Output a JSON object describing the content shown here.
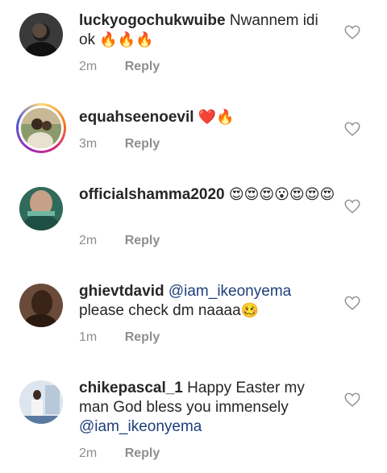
{
  "comments": [
    {
      "username": "luckyogochukwuibe",
      "text": "Nwannem idi ok",
      "emoji": "🔥🔥🔥",
      "time": "2m",
      "reply": "Reply"
    },
    {
      "username": "equahseenoevil",
      "text": "",
      "emoji": "❤️🔥",
      "time": "3m",
      "reply": "Reply"
    },
    {
      "username": "officialshamma2020",
      "text": "",
      "emoji": "😍😍😍😮😍😍😍",
      "time": "2m",
      "reply": "Reply"
    },
    {
      "username": "ghievtdavid",
      "mention": "@iam_ikeonyema",
      "text": "please check dm naaaa",
      "emoji": "🥴",
      "time": "1m",
      "reply": "Reply"
    },
    {
      "username": "chikepascal_1",
      "text": "Happy Easter my man God bless you immensely",
      "mention": "@iam_ikeonyema",
      "time": "2m",
      "reply": "Reply"
    }
  ],
  "colors": {
    "meta": "#8e8e8e",
    "mention": "#1e3f7a",
    "text": "#262626"
  }
}
